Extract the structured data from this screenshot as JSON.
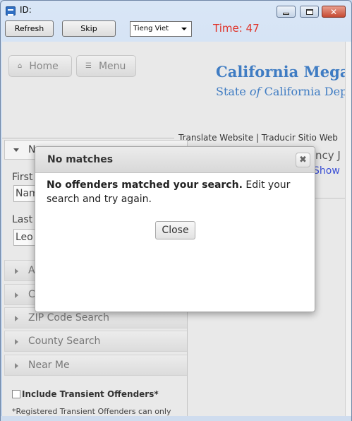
{
  "window": {
    "title": "ID:"
  },
  "toolbar": {
    "refresh_label": "Refresh",
    "skip_label": "Skip",
    "language_selected": "Tieng Viet",
    "timer_text": "Time: 47"
  },
  "site": {
    "home_label": "Home",
    "menu_label": "Menu",
    "brand_line1": "California Megan",
    "brand_line2_pre": "State ",
    "brand_line2_italic": "of",
    "brand_line2_post": " California Depa",
    "translate_text": "Translate Website | Traducir Sitio Web"
  },
  "search_panel": {
    "name_header": "N",
    "first_label": "First",
    "first_value": "Nam",
    "last_label": "Last",
    "last_value": "Leo",
    "accordions": [
      "A",
      "C",
      "ZIP Code Search",
      "County Search",
      "Near Me"
    ],
    "transient_label": "Include Transient Offenders*",
    "transient_note": "*Registered Transient Offenders can only"
  },
  "right_panel": {
    "text1": "ncy J",
    "text2": "Show"
  },
  "modal": {
    "title": "No matches",
    "message_bold": "No offenders matched your search.",
    "message_rest": " Edit your search and try again.",
    "close_label": "Close"
  },
  "colors": {
    "timer": "#e0342a",
    "brand": "#3f7cc3",
    "link": "#3a4fd6"
  }
}
